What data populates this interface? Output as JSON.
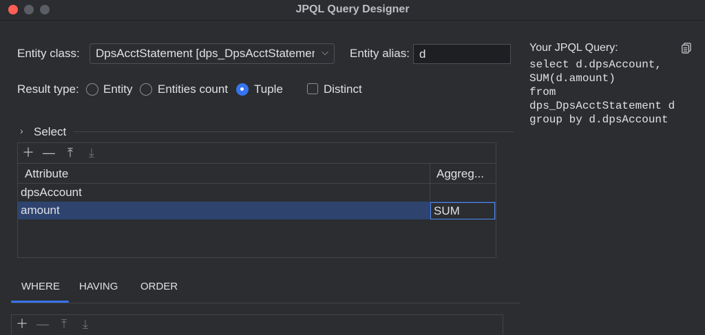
{
  "window": {
    "title": "JPQL Query Designer"
  },
  "form": {
    "entity_class_label": "Entity class:",
    "entity_class_value": "DpsAcctStatement [dps_DpsAcctStatement]",
    "entity_alias_label": "Entity alias:",
    "entity_alias_value": "d",
    "result_type_label": "Result type:",
    "result_types": [
      "Entity",
      "Entities count",
      "Tuple"
    ],
    "result_type_selected": "Tuple",
    "distinct_label": "Distinct",
    "distinct_checked": false
  },
  "select": {
    "section_label": "Select",
    "columns": [
      "Attribute",
      "Aggreg..."
    ],
    "rows": [
      {
        "attribute": "dpsAccount",
        "aggregate": ""
      },
      {
        "attribute": "amount",
        "aggregate": "SUM",
        "selected": true
      }
    ]
  },
  "tabs": [
    "WHERE",
    "HAVING",
    "ORDER"
  ],
  "active_tab": "WHERE",
  "query": {
    "label": "Your JPQL Query:",
    "lines": [
      "select d.dpsAccount,",
      "SUM(d.amount)",
      "from",
      "dps_DpsAcctStatement d",
      "group by d.dpsAccount"
    ]
  },
  "colors": {
    "accent": "#3574f0",
    "selection": "#2e436e",
    "background": "#2b2d30"
  },
  "icons": [
    "add-icon",
    "remove-icon",
    "move-up-icon",
    "move-down-icon",
    "copy-icon",
    "chevron-right-icon",
    "chevron-down-icon"
  ]
}
